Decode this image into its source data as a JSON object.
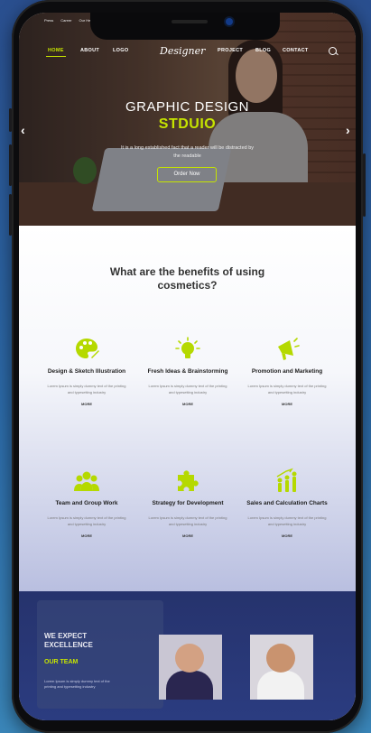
{
  "colors": {
    "accent": "#c6e400",
    "team_bg": "#2b3c80"
  },
  "top_links": [
    "Press",
    "Career",
    "Our He"
  ],
  "nav": {
    "items": [
      "HOME",
      "ABOUT",
      "LOGO",
      "PROJECT",
      "BLOG",
      "CONTACT"
    ],
    "logo": "Designer"
  },
  "hero": {
    "title": "GRAPHIC DESIGN",
    "subtitle": "STDUIO",
    "text": "It is a long established fact that a reader will be distracted by the readable",
    "button": "Order Now"
  },
  "benefits": {
    "title": "What are the benefits of using cosmetics?",
    "cards": [
      {
        "title": "Design & Sketch Illustration",
        "text": "Lorem Ipsum is simply dummy text of the printing and typesetting industry",
        "more": "MORE",
        "icon": "palette-icon"
      },
      {
        "title": "Fresh Ideas & Brainstorming",
        "text": "Lorem Ipsum is simply dummy text of the printing and typesetting industry",
        "more": "MORE",
        "icon": "lightbulb-icon"
      },
      {
        "title": "Promotion and Marketing",
        "text": "Lorem Ipsum is simply dummy text of the printing and typesetting industry",
        "more": "MORE",
        "icon": "megaphone-icon"
      },
      {
        "title": "Team and Group Work",
        "text": "Lorem Ipsum is simply dummy text of the printing and typesetting industry",
        "more": "MORE",
        "icon": "team-icon"
      },
      {
        "title": "Strategy for Development",
        "text": "Lorem Ipsum is simply dummy text of the printing and typesetting industry",
        "more": "MORE",
        "icon": "puzzle-icon"
      },
      {
        "title": "Sales and Calculation Charts",
        "text": "Lorem Ipsum is simply dummy text of the printing and typesetting industry",
        "more": "MORE",
        "icon": "growth-icon"
      }
    ]
  },
  "team": {
    "heading": "WE EXPECT EXCELLENCE",
    "label": "OUR TEAM",
    "text": "Lorem Ipsum is simply dummy text of the printing and typesetting industry"
  }
}
